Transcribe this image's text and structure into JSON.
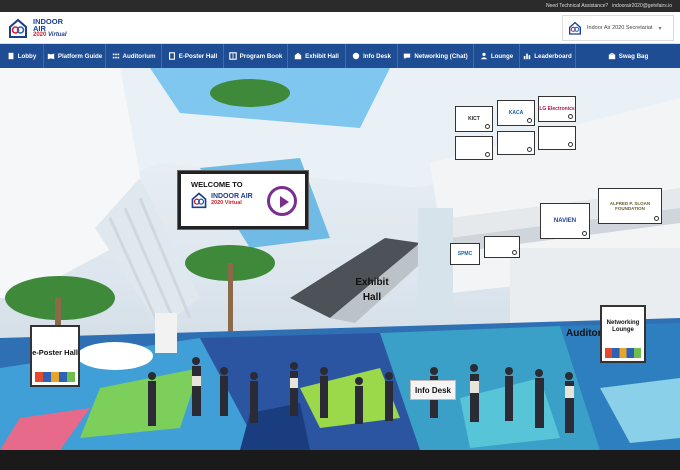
{
  "topbar": {
    "assistance_label": "Need Technical Assistance?",
    "email": "indoorair2020@getvfairs.io"
  },
  "brand": {
    "line1": "INDOOR",
    "line2": "AIR",
    "line3_year": "2020",
    "line3_tag": "Virtual"
  },
  "account": {
    "name": "Indoor Air 2020 Secretariat"
  },
  "nav": {
    "items": [
      {
        "label": "Lobby",
        "icon": "building-icon"
      },
      {
        "label": "Platform Guide",
        "icon": "book-icon"
      },
      {
        "label": "Auditorium",
        "icon": "seats-icon"
      },
      {
        "label": "E-Poster Hall",
        "icon": "poster-icon"
      },
      {
        "label": "Program Book",
        "icon": "program-icon"
      },
      {
        "label": "Exhibit Hall",
        "icon": "booth-icon"
      },
      {
        "label": "Info Desk",
        "icon": "info-icon"
      },
      {
        "label": "Networking (Chat)",
        "icon": "chat-icon"
      },
      {
        "label": "Lounge",
        "icon": "person-icon"
      },
      {
        "label": "Leaderboard",
        "icon": "leaderboard-icon"
      },
      {
        "label": "Swag Bag",
        "icon": "bag-icon"
      }
    ]
  },
  "scene": {
    "welcome_text": "WELCOME TO",
    "welcome_brand": "INDOOR AIR",
    "welcome_year": "2020 Virtual",
    "eposter_label": "e-Poster Hall",
    "exhibit_label": "Exhibit Hall",
    "infodesk_label": "Info Desk",
    "auditorium_label": "Auditorium",
    "networking_label": "Networking Lounge",
    "sponsors": [
      "KICT",
      "KACA",
      "LG Electronics",
      "NAVIEN",
      "ALFRED P. SLOAN FOUNDATION",
      "SPMC"
    ]
  },
  "colors": {
    "nav_bg": "#1e4d93",
    "brand_blue": "#1b3f8f",
    "brand_red": "#d0212a"
  }
}
